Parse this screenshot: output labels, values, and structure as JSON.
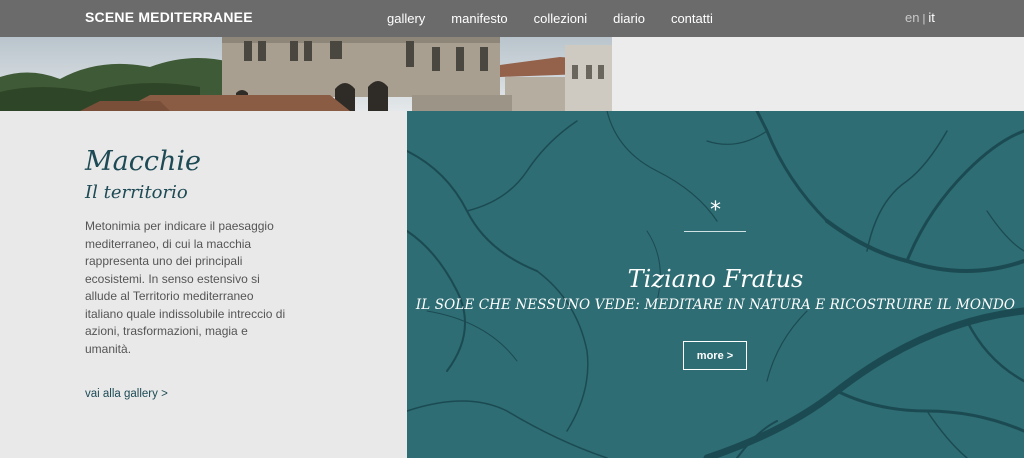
{
  "header": {
    "logo": "SCENE MEDITERRANEE",
    "nav": [
      "gallery",
      "manifesto",
      "collezioni",
      "diario",
      "contatti"
    ],
    "lang_en": "en",
    "lang_sep": "|",
    "lang_it": "it"
  },
  "section": {
    "title": "Macchie",
    "subtitle": "Il territorio",
    "description": "Metonimia per indicare il paesaggio mediterraneo, di cui la macchia rappresenta uno dei principali ecosistemi. In senso estensivo si allude al Territorio mediterraneo italiano quale indissolubile intreccio di azioni, trasformazioni, magia e umanità.",
    "gallery_link": "vai alla gallery >"
  },
  "feature": {
    "asterisk": "*",
    "author": "Tiziano Fratus",
    "title": "IL SOLE CHE NESSUNO VEDE: MEDITARE IN NATURA E RICOSTRUIRE IL MONDO",
    "more_label": "more >"
  },
  "colors": {
    "header_bg": "#6b6b6b",
    "accent": "#1d4a55",
    "feature_bg": "#2d6d73"
  }
}
